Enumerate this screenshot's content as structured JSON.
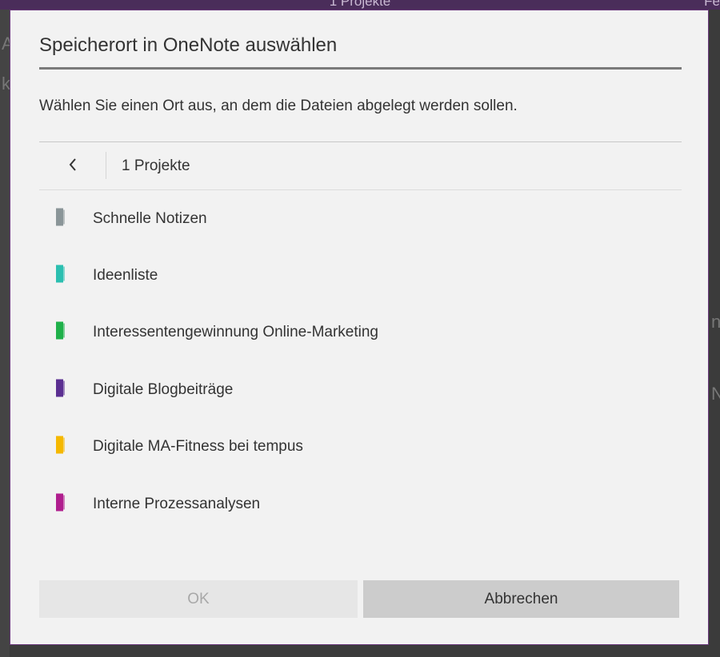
{
  "background_app": {
    "title": "1 Projekte",
    "right_label": "Fe",
    "side_letters": [
      "A",
      "k",
      "n",
      "N"
    ]
  },
  "dialog": {
    "title": "Speicherort in OneNote auswählen",
    "instruction": "Wählen Sie einen Ort aus, an dem die Dateien abgelegt werden sollen.",
    "breadcrumb": "1 Projekte",
    "back_icon": "chevron-left-icon",
    "sections": [
      {
        "label": "Schnelle Notizen",
        "color": "#8a9598"
      },
      {
        "label": "Ideenliste",
        "color": "#2bbfb0"
      },
      {
        "label": "Interessentengewinnung Online-Marketing",
        "color": "#1fb14a"
      },
      {
        "label": "Digitale Blogbeiträge",
        "color": "#5b2f91"
      },
      {
        "label": "Digitale MA-Fitness bei tempus",
        "color": "#f5b800"
      },
      {
        "label": "Interne Prozessanalysen",
        "color": "#b01e8e"
      }
    ],
    "buttons": {
      "ok": "OK",
      "cancel": "Abbrechen"
    }
  }
}
